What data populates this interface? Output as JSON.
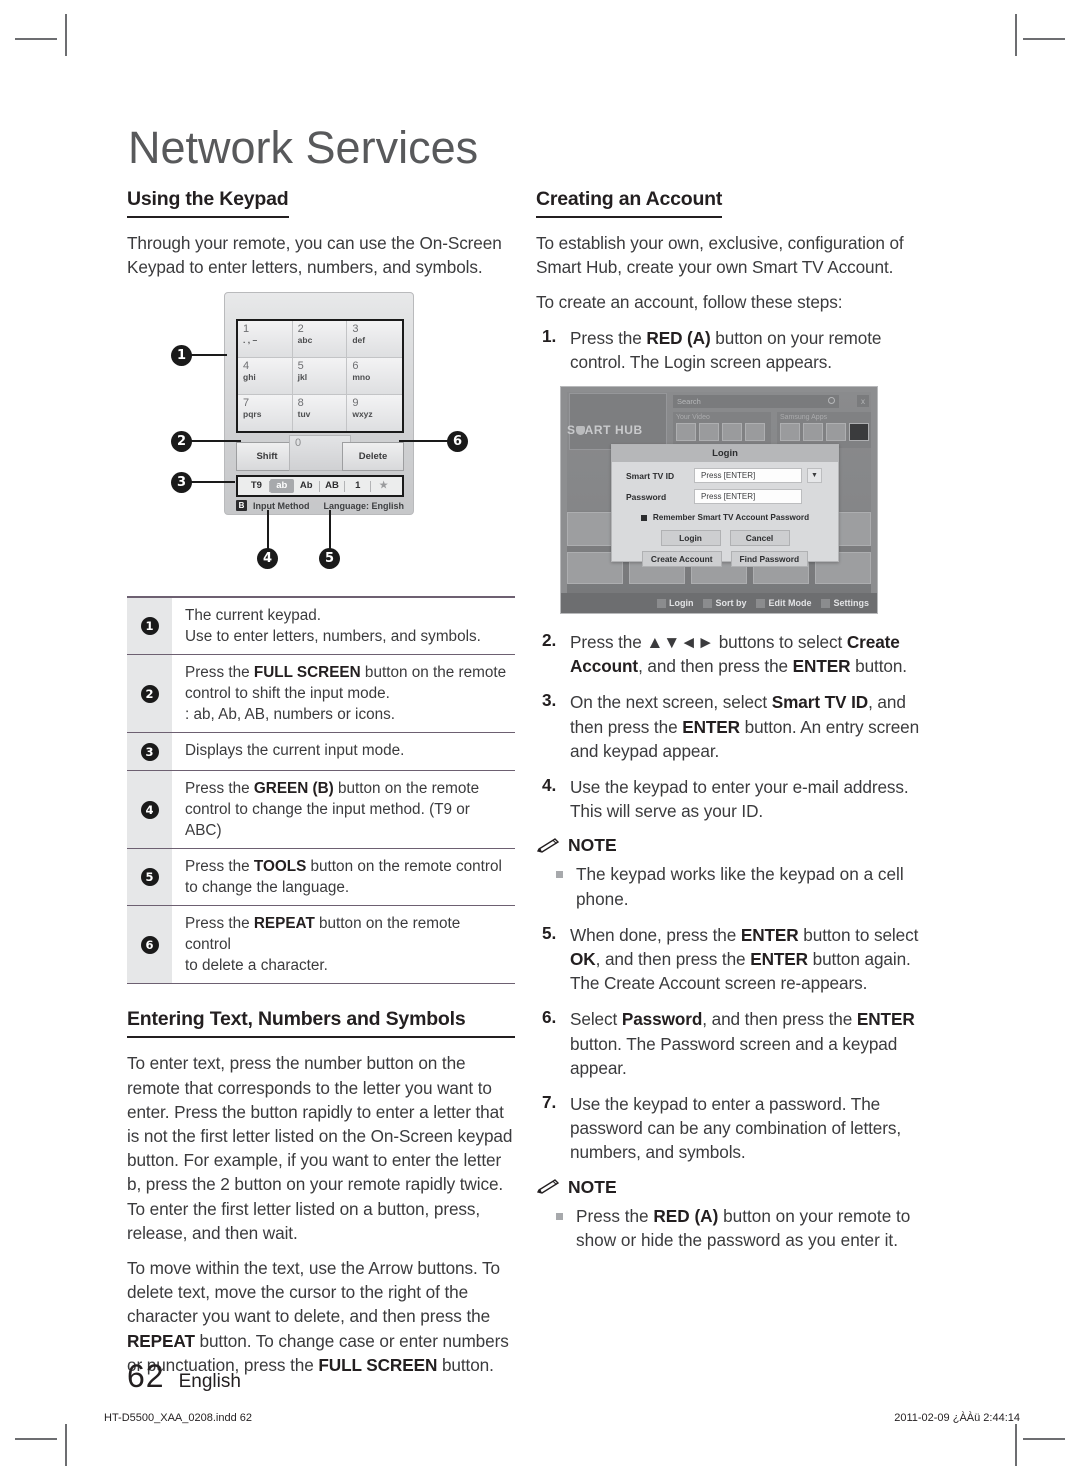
{
  "chapter": {
    "title": "Network Services"
  },
  "left": {
    "section1": {
      "heading": "Using the Keypad",
      "intro": "Through your remote, you can use the On-Screen Keypad to enter letters, numbers, and symbols."
    },
    "keypad": {
      "keys": [
        {
          "num": "1",
          "sub": ". , –"
        },
        {
          "num": "2",
          "sub": "abc"
        },
        {
          "num": "3",
          "sub": "def"
        },
        {
          "num": "4",
          "sub": "ghi"
        },
        {
          "num": "5",
          "sub": "jkl"
        },
        {
          "num": "6",
          "sub": "mno"
        },
        {
          "num": "7",
          "sub": "pqrs"
        },
        {
          "num": "8",
          "sub": "tuv"
        },
        {
          "num": "9",
          "sub": "wxyz"
        }
      ],
      "zero": "0",
      "shift": "Shift",
      "delete": "Delete",
      "modes": [
        "T9",
        "ab",
        "Ab",
        "AB",
        "1",
        "★"
      ],
      "selected_mode": "ab",
      "b_chip": "B",
      "input_method": "Input Method",
      "language": "Language: English",
      "callouts": [
        "1",
        "2",
        "3",
        "4",
        "5",
        "6"
      ]
    },
    "legend": [
      {
        "n": "1",
        "lines": [
          [
            {
              "t": "The current keypad.",
              "b": false
            }
          ],
          [
            {
              "t": "Use to enter letters, numbers, and symbols.",
              "b": false
            }
          ]
        ]
      },
      {
        "n": "2",
        "lines": [
          [
            {
              "t": "Press the ",
              "b": false
            },
            {
              "t": "FULL SCREEN",
              "b": true
            },
            {
              "t": " button on the remote",
              "b": false
            }
          ],
          [
            {
              "t": "control to shift the input mode.",
              "b": false
            }
          ],
          [
            {
              "t": ": ab, Ab, AB, numbers or icons.",
              "b": false
            }
          ]
        ]
      },
      {
        "n": "3",
        "lines": [
          [
            {
              "t": "Displays the current input mode.",
              "b": false
            }
          ]
        ]
      },
      {
        "n": "4",
        "lines": [
          [
            {
              "t": "Press the ",
              "b": false
            },
            {
              "t": "GREEN (B)",
              "b": true
            },
            {
              "t": " button on the remote",
              "b": false
            }
          ],
          [
            {
              "t": "control to change the input method. (T9 or ABC)",
              "b": false
            }
          ]
        ]
      },
      {
        "n": "5",
        "lines": [
          [
            {
              "t": "Press the ",
              "b": false
            },
            {
              "t": "TOOLS",
              "b": true
            },
            {
              "t": " button on the remote control",
              "b": false
            }
          ],
          [
            {
              "t": "to change the language.",
              "b": false
            }
          ]
        ]
      },
      {
        "n": "6",
        "lines": [
          [
            {
              "t": "Press the ",
              "b": false
            },
            {
              "t": "REPEAT",
              "b": true
            },
            {
              "t": " button on the remote control",
              "b": false
            }
          ],
          [
            {
              "t": "to delete a character.",
              "b": false
            }
          ]
        ]
      }
    ],
    "section2": {
      "heading": "Entering Text, Numbers and Symbols",
      "para1": "To enter text, press the number button on the remote that corresponds to the letter you want to enter. Press the button rapidly to enter a letter that is not the first letter listed on the On-Screen keypad button. For example, if you want to enter the letter b, press the 2 button on your remote rapidly twice. To enter the first letter listed on a button, press, release, and then wait.",
      "para2_parts": [
        {
          "t": "To move within the text, use the Arrow buttons. To delete text, move the cursor to the right of the character you want to delete, and then press the ",
          "b": false
        },
        {
          "t": "REPEAT",
          "b": true
        },
        {
          "t": " button. To change case or enter numbers or punctuation, press the ",
          "b": false
        },
        {
          "t": "FULL SCREEN",
          "b": true
        },
        {
          "t": " button.",
          "b": false
        }
      ]
    }
  },
  "right": {
    "section": {
      "heading": "Creating an Account",
      "para1": "To establish your own, exclusive, configuration of Smart Hub, create your own Smart TV Account.",
      "para2": "To create an account, follow these steps:"
    },
    "steps_a": [
      {
        "n": "1.",
        "parts": [
          {
            "t": "Press the ",
            "b": false
          },
          {
            "t": "RED (A)",
            "b": true
          },
          {
            "t": " button on your remote control. The Login screen appears.",
            "b": false
          }
        ]
      }
    ],
    "tv": {
      "hub_label": "ART HUB",
      "search_placeholder": "Search",
      "your_video": "Your Video",
      "samsung_apps": "Samsung Apps",
      "close": "x",
      "dialog": {
        "title": "Login",
        "id_label": "Smart TV ID",
        "id_value": "Press [ENTER]",
        "pw_label": "Password",
        "pw_value": "Press [ENTER]",
        "remember": "Remember Smart TV Account Password",
        "buttons": [
          "Login",
          "Cancel",
          "Create Account",
          "Find Password"
        ]
      },
      "bottom_bar": [
        "Login",
        "Sort by",
        "Edit Mode",
        "Settings"
      ]
    },
    "steps_b": [
      {
        "n": "2.",
        "parts": [
          {
            "t": "Press the ▲▼◄► buttons to select ",
            "b": false
          },
          {
            "t": "Create Account",
            "b": true
          },
          {
            "t": ", and then press the ",
            "b": false
          },
          {
            "t": "ENTER",
            "b": true
          },
          {
            "t": " button.",
            "b": false
          }
        ]
      },
      {
        "n": "3.",
        "parts": [
          {
            "t": "On the next screen, select ",
            "b": false
          },
          {
            "t": "Smart TV ID",
            "b": true
          },
          {
            "t": ", and then press the ",
            "b": false
          },
          {
            "t": "ENTER",
            "b": true
          },
          {
            "t": " button. An entry screen and keypad appear.",
            "b": false
          }
        ]
      },
      {
        "n": "4.",
        "parts": [
          {
            "t": "Use the keypad to enter your e-mail address. This will serve as your ID.",
            "b": false
          }
        ]
      }
    ],
    "note1": {
      "title": "NOTE",
      "items": [
        [
          {
            "t": "The keypad works like the keypad on a cell phone.",
            "b": false
          }
        ]
      ]
    },
    "steps_c": [
      {
        "n": "5.",
        "parts": [
          {
            "t": "When done, press the ",
            "b": false
          },
          {
            "t": "ENTER",
            "b": true
          },
          {
            "t": " button to select ",
            "b": false
          },
          {
            "t": "OK",
            "b": true
          },
          {
            "t": ", and then press the ",
            "b": false
          },
          {
            "t": "ENTER",
            "b": true
          },
          {
            "t": " button again. The Create Account screen re-appears.",
            "b": false
          }
        ]
      },
      {
        "n": "6.",
        "parts": [
          {
            "t": "Select ",
            "b": false
          },
          {
            "t": "Password",
            "b": true
          },
          {
            "t": ", and then press the ",
            "b": false
          },
          {
            "t": "ENTER",
            "b": true
          },
          {
            "t": " button. The Password screen and a keypad appear.",
            "b": false
          }
        ]
      },
      {
        "n": "7.",
        "parts": [
          {
            "t": "Use the keypad to enter a password. The password can be any combination of letters, numbers, and symbols.",
            "b": false
          }
        ]
      }
    ],
    "note2": {
      "title": "NOTE",
      "items": [
        [
          {
            "t": "Press the ",
            "b": false
          },
          {
            "t": "RED (A)",
            "b": true
          },
          {
            "t": " button on your remote to show or hide the password as you enter it.",
            "b": false
          }
        ]
      ]
    }
  },
  "footer": {
    "page_number": "62",
    "language": "English",
    "file_line": "HT-D5500_XAA_0208.indd   62",
    "time_line": "2011-02-09   ¿ÀÀü 2:44:14"
  }
}
